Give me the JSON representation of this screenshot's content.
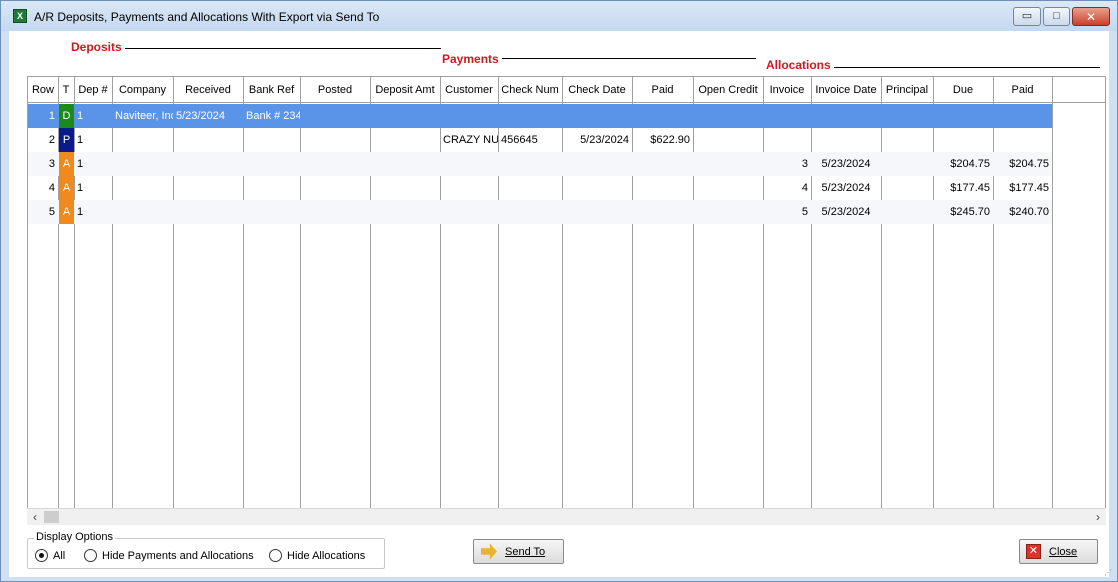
{
  "window": {
    "title": "A/R Deposits, Payments and Allocations With Export via Send To",
    "app_icon": "excel-icon",
    "controls": {
      "minimize": "minimize-icon",
      "maximize": "maximize-icon",
      "close": "close-icon"
    }
  },
  "sections": {
    "deposits": "Deposits",
    "payments": "Payments",
    "allocations": "Allocations"
  },
  "grid": {
    "columns": [
      "Row",
      "T",
      "Dep #",
      "Company",
      "Received",
      "Bank Ref",
      "Posted",
      "Deposit Amt",
      "Customer",
      "Check Num",
      "Check Date",
      "Paid",
      "Open Credit",
      "Invoice",
      "Invoice Date",
      "Principal",
      "Due",
      "Paid"
    ],
    "rows": [
      {
        "row": "1",
        "type": "D",
        "dep": "1",
        "company": "Naviteer, Inc.",
        "received": "5/23/2024",
        "bank_ref": "Bank # 234",
        "posted": "",
        "deposit_amt": "",
        "customer": "",
        "check_num": "",
        "check_date": "",
        "paid": "",
        "open_credit": "",
        "invoice": "",
        "invoice_date": "",
        "principal": "",
        "due": "",
        "alloc_paid": ""
      },
      {
        "row": "2",
        "type": "P",
        "dep": "1",
        "company": "",
        "received": "",
        "bank_ref": "",
        "posted": "",
        "deposit_amt": "",
        "customer": "CRAZY NUTS",
        "check_num": "456645",
        "check_date": "5/23/2024",
        "paid": "$622.90",
        "open_credit": "",
        "invoice": "",
        "invoice_date": "",
        "principal": "",
        "due": "",
        "alloc_paid": ""
      },
      {
        "row": "3",
        "type": "A",
        "dep": "1",
        "company": "",
        "received": "",
        "bank_ref": "",
        "posted": "",
        "deposit_amt": "",
        "customer": "",
        "check_num": "",
        "check_date": "",
        "paid": "",
        "open_credit": "",
        "invoice": "3",
        "invoice_date": "5/23/2024",
        "principal": "",
        "due": "$204.75",
        "alloc_paid": "$204.75"
      },
      {
        "row": "4",
        "type": "A",
        "dep": "1",
        "company": "",
        "received": "",
        "bank_ref": "",
        "posted": "",
        "deposit_amt": "",
        "customer": "",
        "check_num": "",
        "check_date": "",
        "paid": "",
        "open_credit": "",
        "invoice": "4",
        "invoice_date": "5/23/2024",
        "principal": "",
        "due": "$177.45",
        "alloc_paid": "$177.45"
      },
      {
        "row": "5",
        "type": "A",
        "dep": "1",
        "company": "",
        "received": "",
        "bank_ref": "",
        "posted": "",
        "deposit_amt": "",
        "customer": "",
        "check_num": "",
        "check_date": "",
        "paid": "",
        "open_credit": "",
        "invoice": "5",
        "invoice_date": "5/23/2024",
        "principal": "",
        "due": "$245.70",
        "alloc_paid": "$240.70"
      }
    ],
    "type_colors": {
      "D": "#1a8a1a",
      "P": "#0a1a8c",
      "A": "#f08a1c"
    },
    "selected_row_color": "#5a94e8"
  },
  "scrollbar": {
    "left_arrow": "‹",
    "right_arrow": "›"
  },
  "display_options": {
    "title": "Display Options",
    "options": [
      "All",
      "Hide Payments and Allocations",
      "Hide Allocations"
    ],
    "selected": "All"
  },
  "buttons": {
    "send_to": "Send To",
    "close": "Close"
  }
}
